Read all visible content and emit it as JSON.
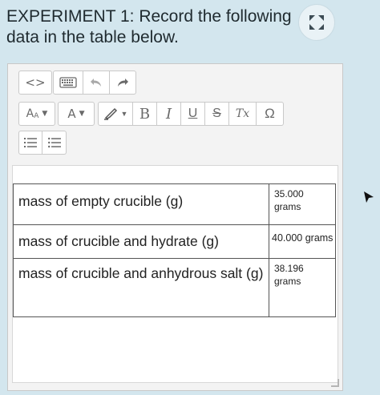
{
  "question": {
    "text": "EXPERIMENT 1: Record the following data in the table below."
  },
  "expand_icon": "expand-arrows-icon",
  "toolbar": {
    "row1": [
      {
        "name": "code-view-button",
        "label": "<>"
      },
      {
        "name": "keyboard-button",
        "icon": "keyboard-icon"
      },
      {
        "name": "undo-button",
        "icon": "undo-icon"
      },
      {
        "name": "redo-button",
        "icon": "redo-icon"
      }
    ],
    "row2": {
      "font_size_label": "A",
      "font_color_label": "A",
      "bold_label": "B",
      "italic_label": "I",
      "underline_label": "U",
      "strike_label": "S",
      "clear_format_label": "Tx",
      "special_char_label": "Ω"
    },
    "row3": [
      "ordered-list-icon",
      "unordered-list-icon"
    ]
  },
  "table": {
    "rows": [
      {
        "label": "mass of empty crucible (g)",
        "value": "35.000 grams"
      },
      {
        "label": "mass of crucible and hydrate (g)",
        "value": "40.000 grams"
      },
      {
        "label": "mass of crucible and anhydrous salt (g)",
        "value": "38.196 grams"
      }
    ]
  },
  "colors": {
    "background": "#d3e6ee",
    "editor_bg": "#f3f3f3",
    "icon_gray": "#6a6a6a"
  }
}
